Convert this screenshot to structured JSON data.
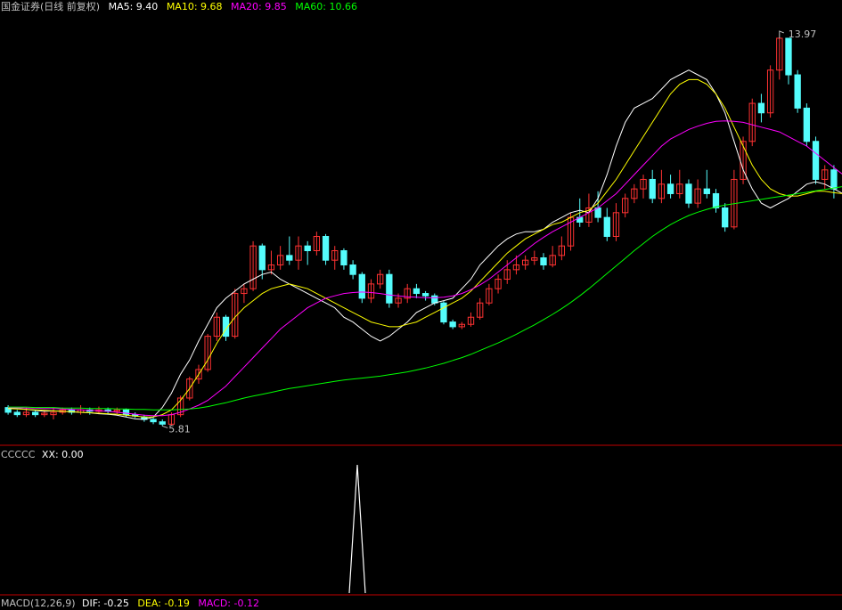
{
  "header": {
    "title": "国金证券(日线 前复权)",
    "ma5": "MA5: 9.40",
    "ma10": "MA10: 9.68",
    "ma20": "MA20: 9.85",
    "ma60": "MA60: 10.66"
  },
  "indicator": {
    "name": "CCCCC",
    "xx": "XX: 0.00"
  },
  "macd": {
    "name": "MACD(12,26,9)",
    "dif": "DIF: -0.25",
    "dea": "DEA: -0.19",
    "macd": "MACD: -0.12"
  },
  "colors": {
    "up": "#ff3232",
    "down": "#54fcfc",
    "ma5": "#ffffff",
    "ma10": "#ffff00",
    "ma20": "#ff00ff",
    "ma60": "#00ff00",
    "separator": "#c00000",
    "text": "#c0c0c0"
  },
  "chart_data": [
    {
      "type": "candlestick",
      "title": "国金证券(日线 前复权)",
      "ylim": [
        5.5,
        14.4
      ],
      "annotations": {
        "high": 13.97,
        "low": 5.81
      },
      "series": [
        {
          "name": "MA5",
          "values": [
            6.19,
            6.18,
            6.16,
            6.14,
            6.12,
            6.13,
            6.12,
            6.11,
            6.1,
            6.09,
            6.07,
            6.06,
            6.04,
            6.0,
            5.96,
            5.95,
            6.0,
            6.2,
            6.5,
            6.9,
            7.2,
            7.6,
            7.95,
            8.3,
            8.5,
            8.65,
            8.8,
            8.9,
            9.0,
            9.05,
            8.9,
            8.8,
            8.7,
            8.6,
            8.5,
            8.4,
            8.3,
            8.1,
            8.0,
            7.85,
            7.7,
            7.6,
            7.7,
            7.85,
            8.0,
            8.2,
            8.3,
            8.4,
            8.45,
            8.5,
            8.7,
            8.9,
            9.2,
            9.4,
            9.6,
            9.75,
            9.85,
            9.9,
            9.9,
            9.95,
            10.1,
            10.2,
            10.3,
            10.35,
            10.3,
            10.6,
            11.1,
            11.7,
            12.2,
            12.5,
            12.6,
            12.7,
            12.9,
            13.1,
            13.2,
            13.3,
            13.2,
            13.1,
            12.8,
            12.4,
            11.8,
            11.2,
            10.8,
            10.5,
            10.4,
            10.5,
            10.6,
            10.75,
            10.9,
            10.95,
            10.9,
            10.8,
            10.7,
            10.65,
            10.6,
            10.55,
            10.5,
            10.45,
            10.4,
            10.35
          ]
        },
        {
          "name": "MA10",
          "values": [
            6.18,
            6.17,
            6.16,
            6.15,
            6.14,
            6.13,
            6.12,
            6.11,
            6.1,
            6.09,
            6.08,
            6.07,
            6.06,
            6.04,
            6.02,
            6.0,
            6.0,
            6.05,
            6.15,
            6.35,
            6.6,
            6.9,
            7.2,
            7.55,
            7.85,
            8.1,
            8.3,
            8.45,
            8.6,
            8.7,
            8.75,
            8.8,
            8.75,
            8.7,
            8.6,
            8.5,
            8.4,
            8.3,
            8.2,
            8.1,
            8.0,
            7.95,
            7.9,
            7.9,
            7.95,
            8.0,
            8.1,
            8.2,
            8.3,
            8.4,
            8.5,
            8.65,
            8.85,
            9.05,
            9.25,
            9.45,
            9.6,
            9.75,
            9.85,
            9.95,
            10.05,
            10.1,
            10.2,
            10.3,
            10.35,
            10.5,
            10.75,
            11.0,
            11.3,
            11.6,
            11.9,
            12.2,
            12.5,
            12.8,
            13.0,
            13.1,
            13.1,
            13.0,
            12.8,
            12.5,
            12.1,
            11.7,
            11.3,
            11.0,
            10.8,
            10.7,
            10.65,
            10.65,
            10.7,
            10.75,
            10.75,
            10.72,
            10.7,
            10.68,
            10.66,
            10.64,
            10.62,
            10.6,
            10.58,
            10.55
          ]
        },
        {
          "name": "MA20",
          "values": [
            6.2,
            6.2,
            6.19,
            6.19,
            6.18,
            6.18,
            6.17,
            6.16,
            6.15,
            6.14,
            6.13,
            6.12,
            6.1,
            6.08,
            6.06,
            6.04,
            6.03,
            6.03,
            6.05,
            6.1,
            6.17,
            6.25,
            6.35,
            6.5,
            6.65,
            6.85,
            7.05,
            7.25,
            7.45,
            7.65,
            7.85,
            8.0,
            8.15,
            8.3,
            8.4,
            8.5,
            8.55,
            8.6,
            8.62,
            8.63,
            8.62,
            8.6,
            8.57,
            8.55,
            8.53,
            8.52,
            8.51,
            8.51,
            8.52,
            8.55,
            8.6,
            8.68,
            8.78,
            8.9,
            9.05,
            9.2,
            9.35,
            9.5,
            9.65,
            9.78,
            9.9,
            10.0,
            10.1,
            10.2,
            10.3,
            10.4,
            10.55,
            10.7,
            10.9,
            11.1,
            11.3,
            11.5,
            11.7,
            11.85,
            11.95,
            12.05,
            12.12,
            12.18,
            12.22,
            12.23,
            12.22,
            12.2,
            12.15,
            12.1,
            12.05,
            12.0,
            11.9,
            11.8,
            11.7,
            11.55,
            11.4,
            11.25,
            11.1,
            10.95,
            10.85,
            10.75,
            10.7,
            10.65,
            10.62,
            10.6
          ]
        },
        {
          "name": "MA60",
          "values": [
            6.21,
            6.21,
            6.21,
            6.2,
            6.2,
            6.2,
            6.19,
            6.19,
            6.19,
            6.18,
            6.18,
            6.18,
            6.17,
            6.17,
            6.16,
            6.16,
            6.15,
            6.15,
            6.15,
            6.16,
            6.17,
            6.19,
            6.22,
            6.26,
            6.3,
            6.35,
            6.4,
            6.44,
            6.48,
            6.52,
            6.56,
            6.6,
            6.63,
            6.66,
            6.69,
            6.72,
            6.75,
            6.78,
            6.8,
            6.82,
            6.84,
            6.86,
            6.89,
            6.92,
            6.95,
            6.99,
            7.03,
            7.08,
            7.13,
            7.19,
            7.25,
            7.32,
            7.4,
            7.48,
            7.56,
            7.65,
            7.74,
            7.84,
            7.94,
            8.05,
            8.16,
            8.28,
            8.41,
            8.55,
            8.7,
            8.86,
            9.02,
            9.18,
            9.34,
            9.5,
            9.65,
            9.8,
            9.93,
            10.05,
            10.15,
            10.24,
            10.31,
            10.37,
            10.42,
            10.46,
            10.49,
            10.52,
            10.55,
            10.58,
            10.61,
            10.64,
            10.67,
            10.7,
            10.73,
            10.76,
            10.79,
            10.82,
            10.85,
            10.88,
            10.92,
            10.96,
            11.0,
            11.05,
            11.1,
            11.15
          ]
        }
      ],
      "candles": [
        [
          6.2,
          6.1,
          6.25,
          6.05
        ],
        [
          6.1,
          6.05,
          6.15,
          6.0
        ],
        [
          6.05,
          6.1,
          6.2,
          6.0
        ],
        [
          6.1,
          6.05,
          6.15,
          6.0
        ],
        [
          6.05,
          6.08,
          6.15,
          6.0
        ],
        [
          6.05,
          6.1,
          6.2,
          5.95
        ],
        [
          6.1,
          6.15,
          6.2,
          6.05
        ],
        [
          6.15,
          6.1,
          6.2,
          6.05
        ],
        [
          6.1,
          6.15,
          6.25,
          6.05
        ],
        [
          6.15,
          6.12,
          6.2,
          6.05
        ],
        [
          6.12,
          6.15,
          6.22,
          6.08
        ],
        [
          6.15,
          6.12,
          6.2,
          6.05
        ],
        [
          6.12,
          6.15,
          6.2,
          6.05
        ],
        [
          6.15,
          6.05,
          6.18,
          6.0
        ],
        [
          6.05,
          6.02,
          6.1,
          5.98
        ],
        [
          6.0,
          5.95,
          6.05,
          5.9
        ],
        [
          5.95,
          5.9,
          6.0,
          5.85
        ],
        [
          5.9,
          5.85,
          5.95,
          5.81
        ],
        [
          5.85,
          6.05,
          6.1,
          5.82
        ],
        [
          6.05,
          6.4,
          6.45,
          6.0
        ],
        [
          6.4,
          6.8,
          6.85,
          6.35
        ],
        [
          6.8,
          7.0,
          7.1,
          6.7
        ],
        [
          7.0,
          7.7,
          7.75,
          6.95
        ],
        [
          7.7,
          8.1,
          8.2,
          7.6
        ],
        [
          8.1,
          7.7,
          8.15,
          7.6
        ],
        [
          7.7,
          8.6,
          8.7,
          7.65
        ],
        [
          8.6,
          8.7,
          8.8,
          8.4
        ],
        [
          8.7,
          9.6,
          9.7,
          8.65
        ],
        [
          9.6,
          9.1,
          9.65,
          8.9
        ],
        [
          9.1,
          9.2,
          9.5,
          9.0
        ],
        [
          9.2,
          9.4,
          9.6,
          9.1
        ],
        [
          9.4,
          9.3,
          9.8,
          9.2
        ],
        [
          9.3,
          9.6,
          9.8,
          9.1
        ],
        [
          9.6,
          9.5,
          9.7,
          9.2
        ],
        [
          9.5,
          9.8,
          9.9,
          9.4
        ],
        [
          9.8,
          9.3,
          9.85,
          9.2
        ],
        [
          9.3,
          9.5,
          9.6,
          9.1
        ],
        [
          9.5,
          9.2,
          9.55,
          9.1
        ],
        [
          9.2,
          9.0,
          9.3,
          8.9
        ],
        [
          9.0,
          8.5,
          9.05,
          8.4
        ],
        [
          8.5,
          8.8,
          8.9,
          8.4
        ],
        [
          8.8,
          9.0,
          9.1,
          8.7
        ],
        [
          9.0,
          8.4,
          9.1,
          8.3
        ],
        [
          8.4,
          8.5,
          8.6,
          8.3
        ],
        [
          8.5,
          8.7,
          8.8,
          8.4
        ],
        [
          8.7,
          8.6,
          8.8,
          8.5
        ],
        [
          8.6,
          8.55,
          8.65,
          8.45
        ],
        [
          8.55,
          8.4,
          8.6,
          8.35
        ],
        [
          8.4,
          8.0,
          8.45,
          7.95
        ],
        [
          8.0,
          7.9,
          8.05,
          7.85
        ],
        [
          7.9,
          7.95,
          8.0,
          7.85
        ],
        [
          7.95,
          8.1,
          8.2,
          7.9
        ],
        [
          8.1,
          8.4,
          8.5,
          8.05
        ],
        [
          8.4,
          8.7,
          8.8,
          8.35
        ],
        [
          8.7,
          8.9,
          9.0,
          8.6
        ],
        [
          8.9,
          9.1,
          9.3,
          8.8
        ],
        [
          9.1,
          9.2,
          9.4,
          9.0
        ],
        [
          9.2,
          9.3,
          9.4,
          9.1
        ],
        [
          9.3,
          9.35,
          9.5,
          9.2
        ],
        [
          9.35,
          9.2,
          9.45,
          9.1
        ],
        [
          9.2,
          9.4,
          9.6,
          9.15
        ],
        [
          9.4,
          9.6,
          9.8,
          9.3
        ],
        [
          9.6,
          10.2,
          10.3,
          9.5
        ],
        [
          10.2,
          10.1,
          10.6,
          10.0
        ],
        [
          10.1,
          10.4,
          10.7,
          10.0
        ],
        [
          10.4,
          10.2,
          10.75,
          10.1
        ],
        [
          10.2,
          9.8,
          10.4,
          9.7
        ],
        [
          9.8,
          10.3,
          10.5,
          9.7
        ],
        [
          10.3,
          10.6,
          10.7,
          10.2
        ],
        [
          10.6,
          10.8,
          10.9,
          10.5
        ],
        [
          10.8,
          11.0,
          11.1,
          10.6
        ],
        [
          11.0,
          10.6,
          11.2,
          10.5
        ],
        [
          10.6,
          10.9,
          11.2,
          10.5
        ],
        [
          10.9,
          10.7,
          11.1,
          10.6
        ],
        [
          10.7,
          10.9,
          11.2,
          10.6
        ],
        [
          10.9,
          10.5,
          11.0,
          10.4
        ],
        [
          10.5,
          10.8,
          11.0,
          10.4
        ],
        [
          10.8,
          10.7,
          11.2,
          10.6
        ],
        [
          10.7,
          10.4,
          10.8,
          10.3
        ],
        [
          10.4,
          10.0,
          10.5,
          9.9
        ],
        [
          10.0,
          11.0,
          11.2,
          9.95
        ],
        [
          11.0,
          11.8,
          11.9,
          10.9
        ],
        [
          11.8,
          12.6,
          12.7,
          11.7
        ],
        [
          12.6,
          12.4,
          12.8,
          12.2
        ],
        [
          12.4,
          13.3,
          13.4,
          12.3
        ],
        [
          13.3,
          13.97,
          13.97,
          13.1
        ],
        [
          13.97,
          13.2,
          13.97,
          13.0
        ],
        [
          13.2,
          12.5,
          13.3,
          12.4
        ],
        [
          12.5,
          11.8,
          12.6,
          11.7
        ],
        [
          11.8,
          11.0,
          11.9,
          10.9
        ],
        [
          11.0,
          11.2,
          11.3,
          10.8
        ],
        [
          11.2,
          10.8,
          11.3,
          10.6
        ]
      ]
    },
    {
      "type": "line",
      "title": "CCCCC",
      "series": [
        {
          "name": "XX",
          "values": [
            0.0
          ]
        }
      ]
    },
    {
      "type": "bar",
      "title": "MACD(12,26,9)",
      "series": [
        {
          "name": "DIF",
          "values": [
            -0.25
          ]
        },
        {
          "name": "DEA",
          "values": [
            -0.19
          ]
        },
        {
          "name": "MACD",
          "values": [
            -0.12
          ]
        }
      ]
    }
  ]
}
